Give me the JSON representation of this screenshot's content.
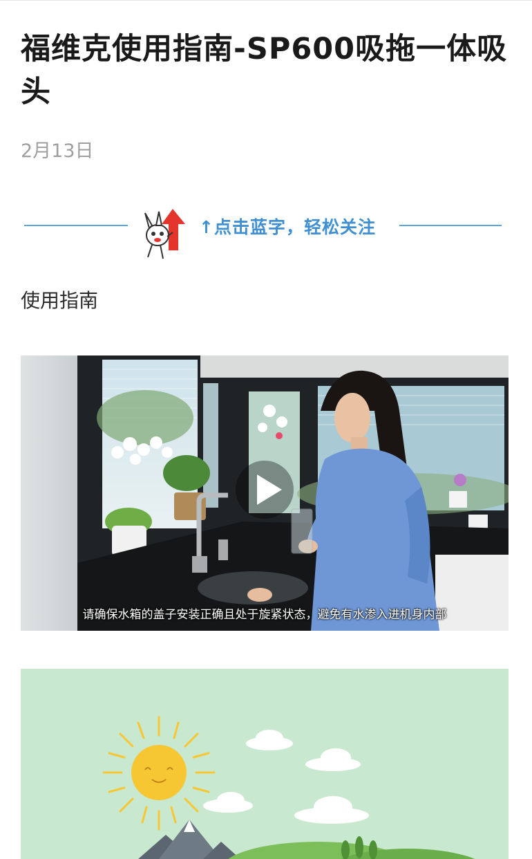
{
  "article": {
    "title": "福维克使用指南-SP600吸拖一体吸头",
    "date": "2月13日"
  },
  "follow_banner": {
    "text": "↑点击蓝字，轻松关注",
    "mascot_icon": "rabbit-arrow-mascot-icon",
    "line_color": "#5aa7dc",
    "text_color": "#3f8fd2"
  },
  "section": {
    "heading": "使用指南"
  },
  "video": {
    "caption": "请确保水箱的盖子安装正确且处于旋紧状态，避免有水渗入进机身内部",
    "play_icon": "play-icon"
  },
  "illustration": {
    "background_color": "#c9e8d0",
    "sun_color": "#f7c733",
    "icons": [
      "sun-icon",
      "cloud-icon",
      "mountain-icon",
      "hill-icon"
    ]
  }
}
